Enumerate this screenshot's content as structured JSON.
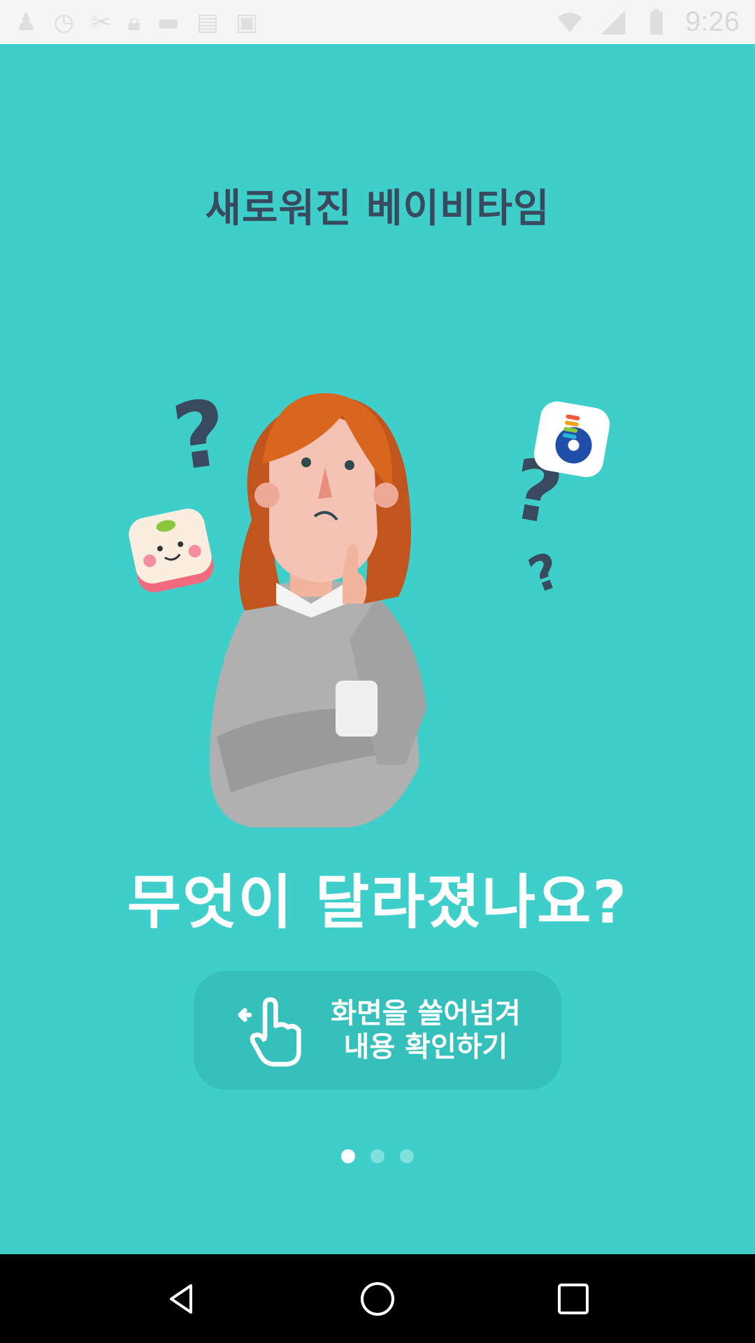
{
  "status_bar": {
    "time": "9:26",
    "icons": [
      "person-icon",
      "clock-icon",
      "tools-icon",
      "lock-icon",
      "android-icon",
      "briefcase-icon",
      "bag-icon"
    ]
  },
  "onboarding": {
    "title": "새로워진 베이비타임",
    "headline": "무엇이 달라졌나요?",
    "swipe_hint_line1": "화면을 쓸어넘겨",
    "swipe_hint_line2": "내용 확인하기",
    "page_indicator": {
      "total": 3,
      "active": 1
    }
  },
  "colors": {
    "background": "#3ecfcb",
    "title": "#3a4a5e",
    "hint_box": "#36c0bc",
    "dot_active": "#ffffff",
    "dot_inactive": "#7fe0dc"
  },
  "navigation": {
    "back": "back-icon",
    "home": "home-icon",
    "recents": "recents-icon"
  }
}
